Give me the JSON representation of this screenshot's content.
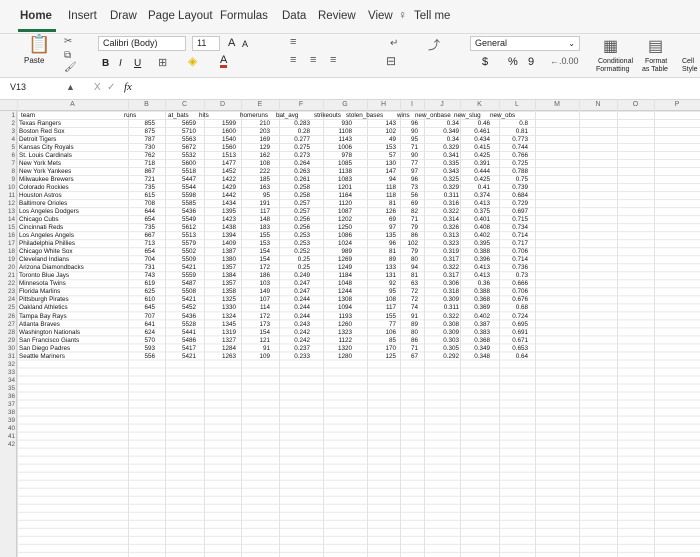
{
  "tabs": [
    "Home",
    "Insert",
    "Draw",
    "Page Layout",
    "Formulas",
    "Data",
    "Review",
    "View",
    "Tell me"
  ],
  "ribbon": {
    "paste": "Paste",
    "font": "Calibri (Body)",
    "size": "11",
    "bold": "B",
    "italic": "I",
    "underline": "U",
    "grow": "A",
    "shrink": "A",
    "font_color": "A",
    "number_format": "General",
    "currency": "$",
    "percent": "%",
    "comma": "9",
    "cond_fmt_1": "Conditional",
    "cond_fmt_2": "Formatting",
    "format_table_1": "Format",
    "format_table_2": "as Table",
    "cell_style_1": "Cell",
    "cell_style_2": "Style"
  },
  "formula_bar": {
    "name_box": "V13",
    "fx": "fx",
    "cancel": "X",
    "enter": "✓",
    "value": ""
  },
  "columns": [
    "A",
    "B",
    "C",
    "D",
    "E",
    "F",
    "G",
    "H",
    "I",
    "J",
    "K",
    "L",
    "M",
    "N",
    "O",
    "P"
  ],
  "headers": [
    "team",
    "runs",
    "at_bats",
    "hits",
    "homeruns",
    "bat_avg",
    "strikeouts",
    "stolen_bases",
    "wins",
    "new_onbase",
    "new_slug",
    "new_obs"
  ],
  "rows": [
    [
      "Texas Rangers",
      "855",
      "5659",
      "1599",
      "210",
      "0.283",
      "930",
      "143",
      "96",
      "0.34",
      "0.46",
      "0.8"
    ],
    [
      "Boston Red Sox",
      "875",
      "5710",
      "1600",
      "203",
      "0.28",
      "1108",
      "102",
      "90",
      "0.349",
      "0.461",
      "0.81"
    ],
    [
      "Detroit Tigers",
      "787",
      "5563",
      "1540",
      "169",
      "0.277",
      "1143",
      "49",
      "95",
      "0.34",
      "0.434",
      "0.773"
    ],
    [
      "Kansas City Royals",
      "730",
      "5672",
      "1560",
      "129",
      "0.275",
      "1006",
      "153",
      "71",
      "0.329",
      "0.415",
      "0.744"
    ],
    [
      "St. Louis Cardinals",
      "762",
      "5532",
      "1513",
      "162",
      "0.273",
      "978",
      "57",
      "90",
      "0.341",
      "0.425",
      "0.766"
    ],
    [
      "New York Mets",
      "718",
      "5600",
      "1477",
      "108",
      "0.264",
      "1085",
      "130",
      "77",
      "0.335",
      "0.391",
      "0.725"
    ],
    [
      "New York Yankees",
      "867",
      "5518",
      "1452",
      "222",
      "0.263",
      "1138",
      "147",
      "97",
      "0.343",
      "0.444",
      "0.788"
    ],
    [
      "Milwaukee Brewers",
      "721",
      "5447",
      "1422",
      "185",
      "0.261",
      "1083",
      "94",
      "96",
      "0.325",
      "0.425",
      "0.75"
    ],
    [
      "Colorado Rockies",
      "735",
      "5544",
      "1429",
      "163",
      "0.258",
      "1201",
      "118",
      "73",
      "0.329",
      "0.41",
      "0.739"
    ],
    [
      "Houston Astros",
      "615",
      "5598",
      "1442",
      "95",
      "0.258",
      "1164",
      "118",
      "56",
      "0.311",
      "0.374",
      "0.684"
    ],
    [
      "Baltimore Orioles",
      "708",
      "5585",
      "1434",
      "191",
      "0.257",
      "1120",
      "81",
      "69",
      "0.316",
      "0.413",
      "0.729"
    ],
    [
      "Los Angeles Dodgers",
      "644",
      "5436",
      "1395",
      "117",
      "0.257",
      "1087",
      "126",
      "82",
      "0.322",
      "0.375",
      "0.697"
    ],
    [
      "Chicago Cubs",
      "654",
      "5549",
      "1423",
      "148",
      "0.256",
      "1202",
      "69",
      "71",
      "0.314",
      "0.401",
      "0.715"
    ],
    [
      "Cincinnati Reds",
      "735",
      "5612",
      "1438",
      "183",
      "0.256",
      "1250",
      "97",
      "79",
      "0.326",
      "0.408",
      "0.734"
    ],
    [
      "Los Angeles Angels",
      "667",
      "5513",
      "1394",
      "155",
      "0.253",
      "1086",
      "135",
      "86",
      "0.313",
      "0.402",
      "0.714"
    ],
    [
      "Philadelphia Phillies",
      "713",
      "5579",
      "1409",
      "153",
      "0.253",
      "1024",
      "96",
      "102",
      "0.323",
      "0.395",
      "0.717"
    ],
    [
      "Chicago White Sox",
      "654",
      "5502",
      "1387",
      "154",
      "0.252",
      "989",
      "81",
      "79",
      "0.319",
      "0.388",
      "0.706"
    ],
    [
      "Cleveland Indians",
      "704",
      "5509",
      "1380",
      "154",
      "0.25",
      "1269",
      "89",
      "80",
      "0.317",
      "0.396",
      "0.714"
    ],
    [
      "Arizona Diamondbacks",
      "731",
      "5421",
      "1357",
      "172",
      "0.25",
      "1249",
      "133",
      "94",
      "0.322",
      "0.413",
      "0.736"
    ],
    [
      "Toronto Blue Jays",
      "743",
      "5559",
      "1384",
      "186",
      "0.249",
      "1184",
      "131",
      "81",
      "0.317",
      "0.413",
      "0.73"
    ],
    [
      "Minnesota Twins",
      "619",
      "5487",
      "1357",
      "103",
      "0.247",
      "1048",
      "92",
      "63",
      "0.306",
      "0.36",
      "0.666"
    ],
    [
      "Florida Marlins",
      "625",
      "5508",
      "1358",
      "149",
      "0.247",
      "1244",
      "95",
      "72",
      "0.318",
      "0.388",
      "0.706"
    ],
    [
      "Pittsburgh Pirates",
      "610",
      "5421",
      "1325",
      "107",
      "0.244",
      "1308",
      "108",
      "72",
      "0.309",
      "0.368",
      "0.676"
    ],
    [
      "Oakland Athletics",
      "645",
      "5452",
      "1330",
      "114",
      "0.244",
      "1094",
      "117",
      "74",
      "0.311",
      "0.369",
      "0.68"
    ],
    [
      "Tampa Bay Rays",
      "707",
      "5436",
      "1324",
      "172",
      "0.244",
      "1193",
      "155",
      "91",
      "0.322",
      "0.402",
      "0.724"
    ],
    [
      "Atlanta Braves",
      "641",
      "5528",
      "1345",
      "173",
      "0.243",
      "1260",
      "77",
      "89",
      "0.308",
      "0.387",
      "0.695"
    ],
    [
      "Washington Nationals",
      "624",
      "5441",
      "1319",
      "154",
      "0.242",
      "1323",
      "106",
      "80",
      "0.309",
      "0.383",
      "0.691"
    ],
    [
      "San Francisco Giants",
      "570",
      "5486",
      "1327",
      "121",
      "0.242",
      "1122",
      "85",
      "86",
      "0.303",
      "0.368",
      "0.671"
    ],
    [
      "San Diego Padres",
      "593",
      "5417",
      "1284",
      "91",
      "0.237",
      "1320",
      "170",
      "71",
      "0.305",
      "0.349",
      "0.653"
    ],
    [
      "Seattle Mariners",
      "556",
      "5421",
      "1263",
      "109",
      "0.233",
      "1280",
      "125",
      "67",
      "0.292",
      "0.348",
      "0.64"
    ]
  ],
  "row_numbers": [
    "1",
    "2",
    "3",
    "4",
    "5",
    "6",
    "7",
    "8",
    "9",
    "10",
    "11",
    "12",
    "13",
    "14",
    "15",
    "16",
    "17",
    "18",
    "19",
    "20",
    "21",
    "22",
    "23",
    "24",
    "25",
    "26",
    "27",
    "28",
    "29",
    "30",
    "31",
    "32",
    "33",
    "34",
    "35",
    "36",
    "37",
    "38",
    "39",
    "40",
    "41",
    "42"
  ]
}
